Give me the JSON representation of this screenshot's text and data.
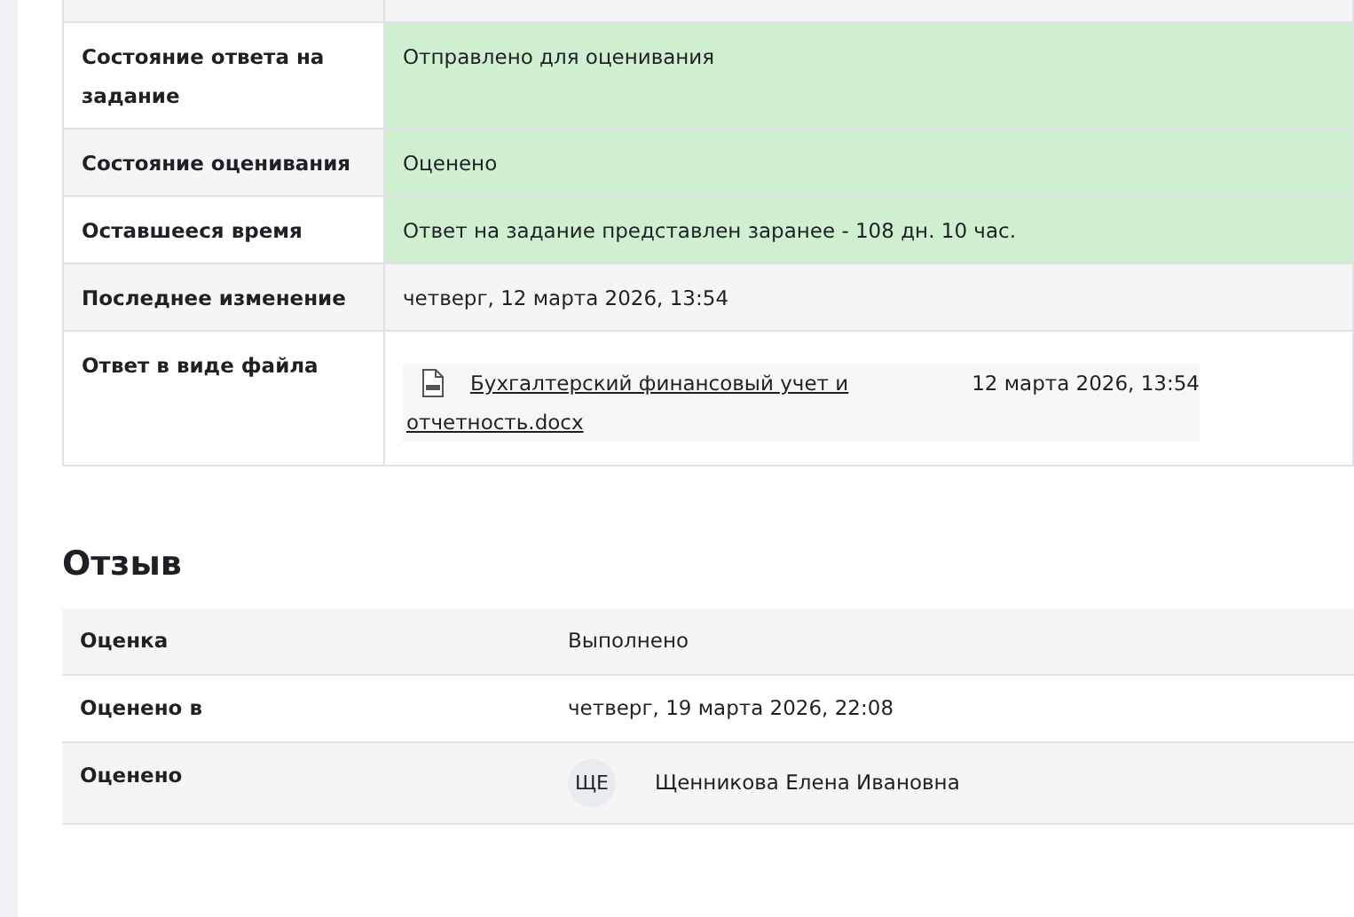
{
  "submission": {
    "rows": [
      {
        "label": "Состояние ответа на задание",
        "value": "Отправлено для оценивания",
        "highlight": true,
        "kind": "text"
      },
      {
        "label": "Состояние оценивания",
        "value": "Оценено",
        "highlight": true,
        "kind": "text"
      },
      {
        "label": "Оставшееся время",
        "value": "Ответ на задание представлен заранее - 108 дн. 10 час.",
        "highlight": true,
        "kind": "text"
      },
      {
        "label": "Последнее изменение",
        "value": "четверг, 12 марта 2026, 13:54",
        "highlight": false,
        "kind": "text"
      },
      {
        "label": "Ответ в виде файла",
        "kind": "file",
        "highlight": false,
        "file": {
          "name": "Бухгалтерский финансовый учет и отчетность.docx",
          "date": "12 марта 2026, 13:54"
        }
      }
    ]
  },
  "feedback": {
    "title": "Отзыв",
    "rows": [
      {
        "label": "Оценка",
        "value": "Выполнено",
        "kind": "text"
      },
      {
        "label": "Оценено в",
        "value": "четверг, 19 марта 2026, 22:08",
        "kind": "text"
      },
      {
        "label": "Оценено",
        "kind": "user",
        "initials": "ЩЕ",
        "value": "Щенникова Елена Ивановна"
      }
    ]
  }
}
